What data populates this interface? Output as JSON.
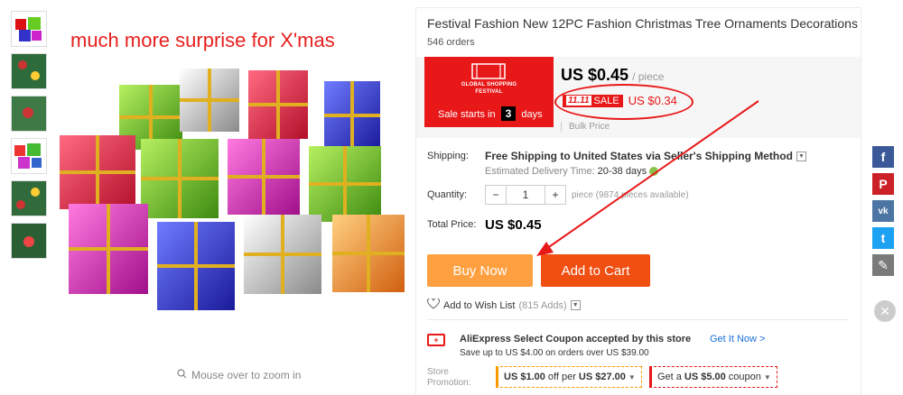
{
  "gallery": {
    "promo_text": "much more surprise for X'mas",
    "zoom_hint": "Mouse over to zoom in",
    "thumbnail_count": 6
  },
  "product": {
    "title": "Festival Fashion New 12PC Fashion Christmas Tree Ornaments Decorations",
    "orders": "546 orders"
  },
  "festival": {
    "logo_text": "11.11",
    "name_line1": "GLOBAL SHOPPING",
    "name_line2": "FESTIVAL",
    "sale_starts_prefix": "Sale starts in",
    "days_value": "3",
    "days_label": "days"
  },
  "price": {
    "value": "US $0.45",
    "unit": "/ piece",
    "sale_badge_logo": "11.11",
    "sale_badge_text": "SALE",
    "sale_price": "US $0.34",
    "bulk_price": "Bulk Price"
  },
  "shipping": {
    "label": "Shipping:",
    "text": "Free Shipping to United States via Seller's Shipping Method",
    "delivery_label": "Estimated Delivery Time:",
    "delivery_value": "20-38 days"
  },
  "quantity": {
    "label": "Quantity:",
    "minus": "−",
    "value": "1",
    "plus": "+",
    "available": "piece (9874 pieces available)"
  },
  "total": {
    "label": "Total Price:",
    "value": "US $0.45"
  },
  "actions": {
    "buy_now": "Buy Now",
    "add_to_cart": "Add to Cart",
    "wish_list": "Add to Wish List",
    "wish_count": "(815 Adds)"
  },
  "coupon": {
    "title": "AliExpress Select Coupon accepted by this store",
    "subtitle": "Save up to US $4.00 on orders over US $39.00",
    "link": "Get It Now >"
  },
  "store_promotion": {
    "label_line1": "Store",
    "label_line2": "Promotion:",
    "chip1_amount": "US $1.00",
    "chip1_mid": "off per",
    "chip1_threshold": "US $27.00",
    "chip2_prefix": "Get a",
    "chip2_amount": "US $5.00",
    "chip2_suffix": "coupon"
  },
  "share": {
    "facebook": "f",
    "pinterest": "P",
    "vk": "vk",
    "twitter": "t",
    "edit": "✎",
    "close": "✕"
  },
  "colors": {
    "accent_red": "#e81718",
    "buy_now": "#ffa040",
    "add_to_cart": "#f14e12",
    "link_blue": "#1a6ed8"
  }
}
